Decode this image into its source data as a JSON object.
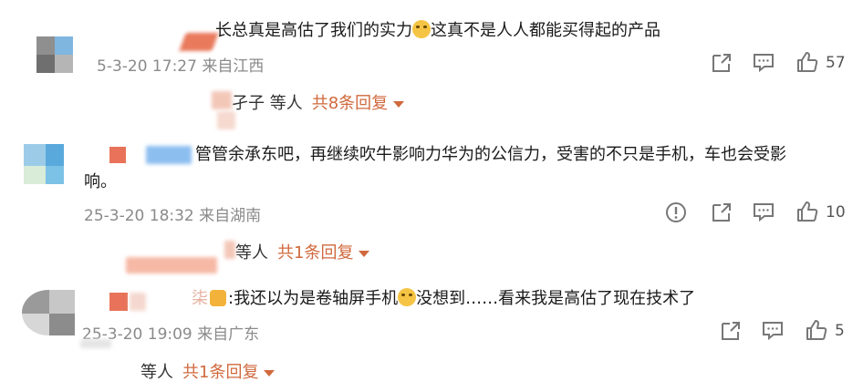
{
  "comments": [
    {
      "text": "长总真是高估了我们的实力",
      "text_after": "这真不是人人都能买得起的产品",
      "meta": "5-3-20 17:27 来自江西",
      "likes": "57",
      "reply_names": "孑子 等人",
      "reply_count": "共8条回复"
    },
    {
      "text": "管管余承东吧，再继续吹牛影响力华为的公信力，受害的不只是手机，车也会受影",
      "text_line2": "响。",
      "meta": "25-3-20 18:32 来自湖南",
      "likes": "10",
      "reply_names": "等人",
      "reply_count": "共1条回复"
    },
    {
      "text_prefix": "柒",
      "text": ":我还以为是卷轴屏手机",
      "text_after": "没想到……看来我是高估了现在技术了",
      "meta": "25-3-20 19:09 来自广东",
      "likes": "5",
      "reply_names": "等人",
      "reply_count": "共1条回复"
    }
  ],
  "icons": {
    "share": "share-icon",
    "comment": "comment-icon",
    "like": "thumbs-up-icon",
    "report": "warning-icon",
    "dropdown": "chevron-down-icon"
  },
  "colors": {
    "accent": "#d0693d",
    "meta": "#8a8a8a"
  }
}
